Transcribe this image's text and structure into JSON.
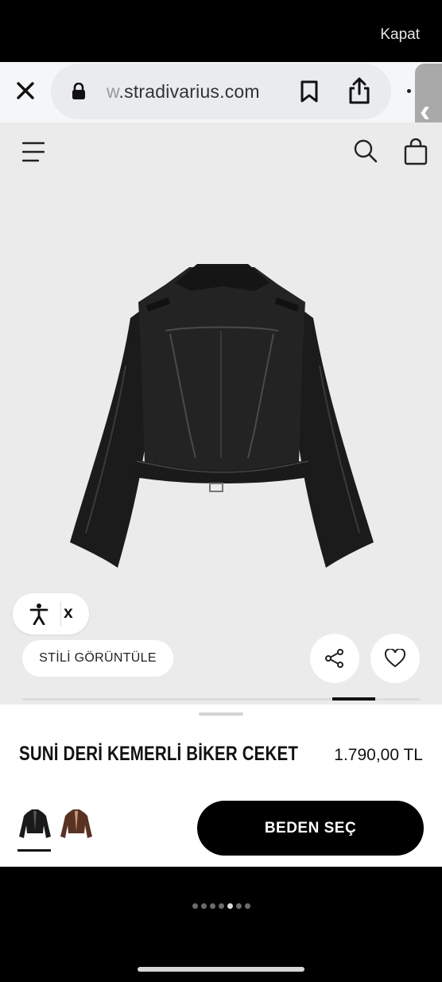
{
  "overlay": {
    "close_label": "Kapat"
  },
  "browser": {
    "url_faded": "w",
    "url_text": ".stradivarius.com"
  },
  "product": {
    "style_button": "STİLİ GÖRÜNTÜLE",
    "title": "SUNİ DERİ KEMERLİ BİKER CEKET",
    "price": "1.790,00 TL",
    "size_button": "BEDEN SEÇ",
    "accessibility_close": "x",
    "image_index": 4,
    "image_count": 6,
    "colors": [
      {
        "name": "black-swatch",
        "hex": "#1a1a1a",
        "selected": true
      },
      {
        "name": "brown-swatch",
        "hex": "#5a3222",
        "selected": false
      }
    ]
  },
  "pager": {
    "dots": 7,
    "active": 4
  },
  "colors": {
    "accent": "#000000",
    "background": "#ebebeb"
  }
}
